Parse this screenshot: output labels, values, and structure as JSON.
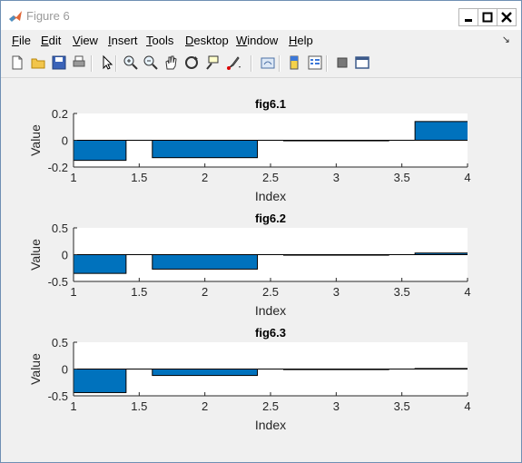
{
  "window": {
    "title": "Figure 6"
  },
  "menu": [
    {
      "label": "File",
      "u": "F",
      "rest": "ile"
    },
    {
      "label": "Edit",
      "u": "E",
      "rest": "dit"
    },
    {
      "label": "View",
      "u": "V",
      "rest": "iew"
    },
    {
      "label": "Insert",
      "u": "I",
      "rest": "nsert"
    },
    {
      "label": "Tools",
      "u": "T",
      "rest": "ools"
    },
    {
      "label": "Desktop",
      "u": "D",
      "rest": "esktop"
    },
    {
      "label": "Window",
      "u": "W",
      "rest": "indow"
    },
    {
      "label": "Help",
      "u": "H",
      "rest": "elp"
    }
  ],
  "toolbar": [
    "new-figure-icon",
    "open-file-icon",
    "save-icon",
    "print-icon",
    "pointer-icon",
    "zoom-in-icon",
    "zoom-out-icon",
    "pan-icon",
    "rotate-3d-icon",
    "data-cursor-icon",
    "brush-icon",
    "link-plot-icon",
    "colorbar-icon",
    "legend-icon",
    "hide-plot-tools-icon",
    "show-plot-tools-icon"
  ],
  "colors": {
    "bar_fill": "#0072bd",
    "bar_edge": "#000000",
    "axes_bg": "#ffffff",
    "figure_bg": "#f0f0f0"
  },
  "chart_data": [
    {
      "type": "bar",
      "title": "fig6.1",
      "xlabel": "Index",
      "ylabel": "Value",
      "x": [
        1,
        2,
        3,
        4
      ],
      "values": [
        -0.15,
        -0.13,
        0.0,
        0.14
      ],
      "bar_width": 0.8,
      "xlim": [
        1,
        4
      ],
      "ylim": [
        -0.2,
        0.2
      ],
      "xticks": [
        "1",
        "1.5",
        "2",
        "2.5",
        "3",
        "3.5",
        "4"
      ],
      "yticks": [
        "0.2",
        "0",
        "-0.2"
      ],
      "ytick_values": [
        0.2,
        0,
        -0.2
      ]
    },
    {
      "type": "bar",
      "title": "fig6.2",
      "xlabel": "Index",
      "ylabel": "Value",
      "x": [
        1,
        2,
        3,
        4
      ],
      "values": [
        -0.35,
        -0.27,
        0.0,
        0.03
      ],
      "bar_width": 0.8,
      "xlim": [
        1,
        4
      ],
      "ylim": [
        -0.5,
        0.5
      ],
      "xticks": [
        "1",
        "1.5",
        "2",
        "2.5",
        "3",
        "3.5",
        "4"
      ],
      "yticks": [
        "0.5",
        "0",
        "-0.5"
      ],
      "ytick_values": [
        0.5,
        0,
        -0.5
      ]
    },
    {
      "type": "bar",
      "title": "fig6.3",
      "xlabel": "Index",
      "ylabel": "Value",
      "x": [
        1,
        2,
        3,
        4
      ],
      "values": [
        -0.44,
        -0.12,
        0.0,
        0.01
      ],
      "bar_width": 0.8,
      "xlim": [
        1,
        4
      ],
      "ylim": [
        -0.5,
        0.5
      ],
      "xticks": [
        "1",
        "1.5",
        "2",
        "2.5",
        "3",
        "3.5",
        "4"
      ],
      "yticks": [
        "0.5",
        "0",
        "-0.5"
      ],
      "ytick_values": [
        0.5,
        0,
        -0.5
      ]
    }
  ]
}
